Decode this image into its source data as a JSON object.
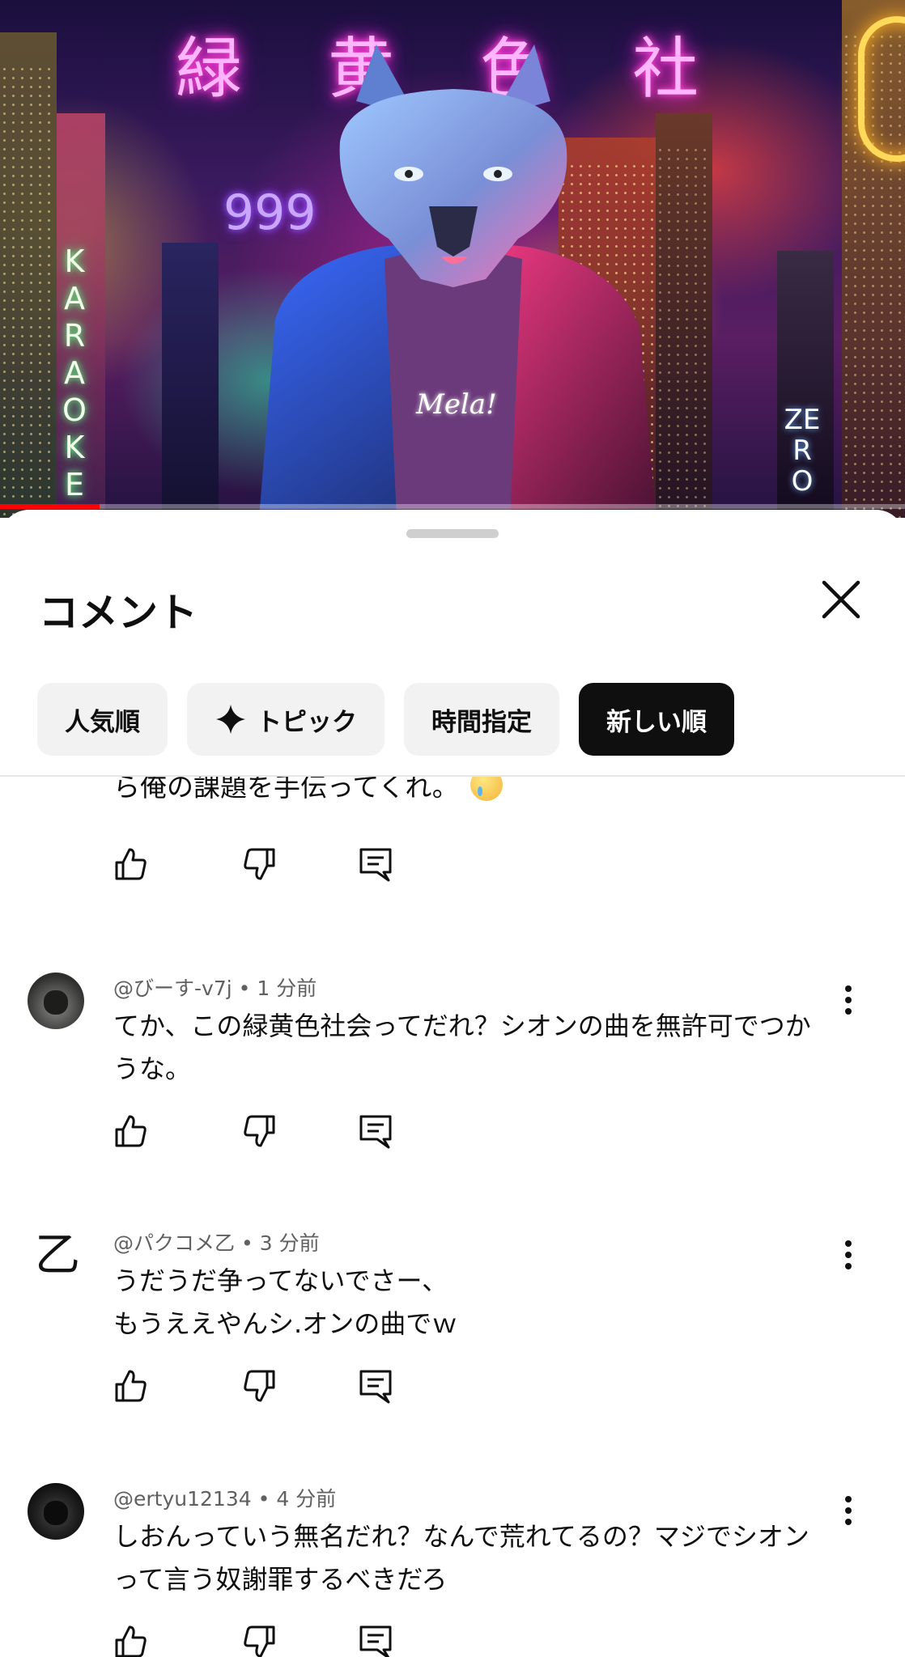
{
  "video": {
    "neon_sign": "緑 黄 色 社 会",
    "neon_999": "999",
    "karaoke_sign": "KARAOKE",
    "zero_sign": "ZERO",
    "shirt_text": "Mela!",
    "progress_fraction": 0.11
  },
  "sheet": {
    "title": "コメント",
    "close_icon": "close-icon"
  },
  "chips": [
    {
      "label": "人気順",
      "active": false
    },
    {
      "label": "トピック",
      "active": false,
      "icon": "sparkle-icon"
    },
    {
      "label": "時間指定",
      "active": false
    },
    {
      "label": "新しい順",
      "active": true
    }
  ],
  "comments": {
    "partial": {
      "text": "ら俺の課題を手伝ってくれ。",
      "emoji": "crying-face"
    },
    "items": [
      {
        "author": "@びーす-v7j",
        "time": "1 分前",
        "lines": [
          "てか、この緑黄色社会ってだれ？シオンの曲を無許可でつか",
          "うな。"
        ]
      },
      {
        "author": "@パクコメ乙",
        "time": "3 分前",
        "avatar_glyph": "乙",
        "lines": [
          "うだうだ争ってないでさー、",
          "もうええやんシ.オンの曲でｗ"
        ]
      },
      {
        "author": "@ertyu12134",
        "time": "4 分前",
        "lines": [
          "しおんっていう無名だれ？なんで荒れてるの？マジでシオン",
          "って言う奴謝罪するべきだろ"
        ]
      }
    ]
  }
}
